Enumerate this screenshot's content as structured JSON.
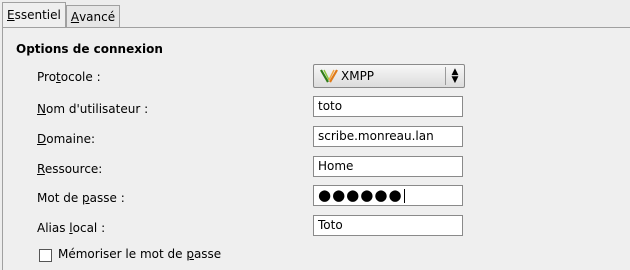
{
  "tabs": [
    {
      "pre": "",
      "u": "E",
      "post": "ssentiel"
    },
    {
      "pre": "",
      "u": "A",
      "post": "vancé"
    }
  ],
  "section_title": "Options de connexion",
  "form": {
    "protocol": {
      "label_pre": "Pro",
      "label_u": "t",
      "label_post": "ocole :",
      "value": "XMPP"
    },
    "username": {
      "label_pre": "",
      "label_u": "N",
      "label_post": "om d'utilisateur :",
      "value": "toto"
    },
    "domain": {
      "label_pre": "",
      "label_u": "D",
      "label_post": "omaine:",
      "value": "scribe.monreau.lan"
    },
    "resource": {
      "label_pre": "",
      "label_u": "R",
      "label_post": "essource:",
      "value": "Home"
    },
    "password": {
      "label_pre": "Mot de ",
      "label_u": "p",
      "label_post": "asse :",
      "value": "●●●●●●"
    },
    "alias": {
      "label_pre": "Alias ",
      "label_u": "l",
      "label_post": "ocal :",
      "value": "Toto"
    }
  },
  "remember": {
    "label_pre": "Mémoriser le mot de ",
    "label_u": "p",
    "label_post": "asse",
    "checked": false
  },
  "icons": {
    "protocol": "xmpp-icon",
    "combo_arrow": "up-down-arrow-icon"
  }
}
